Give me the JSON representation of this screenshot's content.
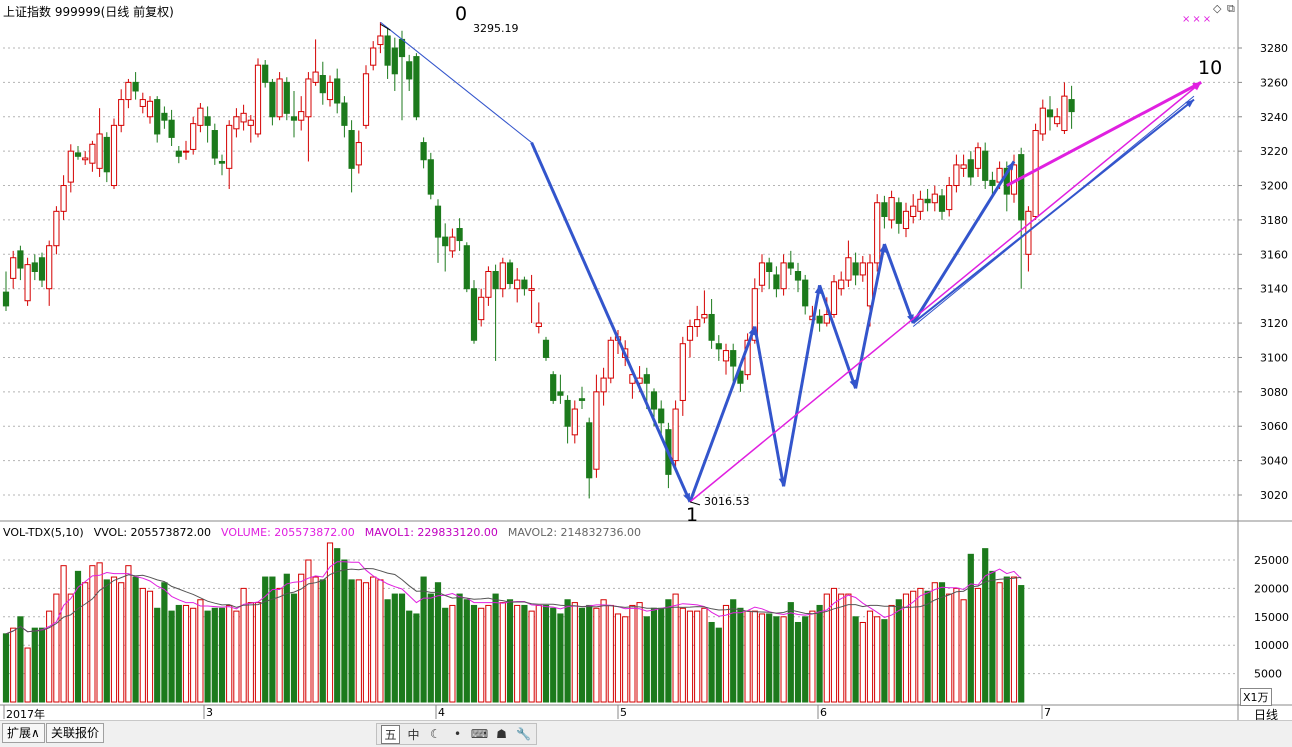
{
  "header": {
    "title": "上证指数 999999(日线 前复权)",
    "icon_labels": [
      "diamond-icon",
      "restore-window-icon"
    ],
    "marks": "×××"
  },
  "wave_labels": {
    "label_0": "0",
    "label_1": "1",
    "label_10": "10",
    "high_value": "3295.19",
    "low_value": "3016.53"
  },
  "volume_header": {
    "name": "VOL-TDX(5,10)",
    "vvol": "VVOL: 205573872.00",
    "volume": "VOLUME: 205573872.00",
    "mavol1": "MAVOL1: 229833120.00",
    "mavol2": "MAVOL2: 214832736.00"
  },
  "x_axis": {
    "labels": [
      "2017年",
      "3",
      "4",
      "5",
      "6",
      "7"
    ],
    "period_label": "日线"
  },
  "volume_unit": "X1万",
  "bottom_tabs": [
    "扩展∧",
    "关联报价"
  ],
  "toolbar": {
    "items": [
      {
        "icon": "calendar-icon",
        "glyph": "五"
      },
      {
        "icon": "text-icon",
        "glyph": "中"
      },
      {
        "icon": "moon-icon",
        "glyph": "☾"
      },
      {
        "icon": "dot-icon",
        "glyph": "•"
      },
      {
        "icon": "keyboard-icon",
        "glyph": "⌨"
      },
      {
        "icon": "user-icon",
        "glyph": "☗"
      },
      {
        "icon": "wrench-icon",
        "glyph": "🔧"
      }
    ]
  },
  "colors": {
    "up": "#d40000",
    "down": "#1c7a1c",
    "wave_blue": "#3355cc",
    "magenta": "#e020e0",
    "grid": "#b4b4b4"
  },
  "chart_data": {
    "type": "candlestick",
    "price_axis": {
      "ticks": [
        3020,
        3040,
        3060,
        3080,
        3100,
        3120,
        3140,
        3160,
        3180,
        3200,
        3220,
        3240,
        3260,
        3280
      ],
      "range": [
        3010,
        3300
      ]
    },
    "volume_axis": {
      "ticks": [
        5000,
        10000,
        15000,
        20000,
        25000
      ],
      "range": [
        0,
        30000
      ],
      "unit": "X1万"
    },
    "candles": [
      [
        3138,
        3130,
        3150,
        3127
      ],
      [
        3146,
        3158,
        3162,
        3140
      ],
      [
        3162,
        3152,
        3165,
        3145
      ],
      [
        3133,
        3154,
        3158,
        3130
      ],
      [
        3155,
        3150,
        3160,
        3145
      ],
      [
        3158,
        3145,
        3161,
        3141
      ],
      [
        3140,
        3165,
        3168,
        3130
      ],
      [
        3165,
        3185,
        3188,
        3160
      ],
      [
        3185,
        3200,
        3206,
        3180
      ],
      [
        3202,
        3220,
        3224,
        3196
      ],
      [
        3219,
        3217,
        3223,
        3215
      ],
      [
        3215,
        3216,
        3220,
        3212
      ],
      [
        3213,
        3224,
        3226,
        3208
      ],
      [
        3210,
        3230,
        3245,
        3205
      ],
      [
        3228,
        3208,
        3231,
        3202
      ],
      [
        3200,
        3235,
        3239,
        3198
      ],
      [
        3235,
        3250,
        3256,
        3231
      ],
      [
        3250,
        3260,
        3262,
        3245
      ],
      [
        3260,
        3255,
        3266,
        3250
      ],
      [
        3246,
        3250,
        3254,
        3242
      ],
      [
        3240,
        3249,
        3252,
        3236
      ],
      [
        3250,
        3230,
        3252,
        3225
      ],
      [
        3242,
        3238,
        3246,
        3233
      ],
      [
        3238,
        3228,
        3244,
        3223
      ],
      [
        3220,
        3217,
        3223,
        3213
      ],
      [
        3220,
        3220,
        3226,
        3215
      ],
      [
        3221,
        3236,
        3240,
        3218
      ],
      [
        3235,
        3245,
        3248,
        3231
      ],
      [
        3240,
        3235,
        3246,
        3225
      ],
      [
        3232,
        3216,
        3236,
        3212
      ],
      [
        3214,
        3213,
        3218,
        3206
      ],
      [
        3210,
        3235,
        3238,
        3198
      ],
      [
        3233,
        3240,
        3245,
        3228
      ],
      [
        3237,
        3242,
        3247,
        3232
      ],
      [
        3235,
        3238,
        3241,
        3225
      ],
      [
        3230,
        3270,
        3274,
        3228
      ],
      [
        3270,
        3260,
        3273,
        3257
      ],
      [
        3260,
        3240,
        3262,
        3235
      ],
      [
        3240,
        3262,
        3266,
        3238
      ],
      [
        3260,
        3242,
        3263,
        3238
      ],
      [
        3240,
        3238,
        3255,
        3228
      ],
      [
        3238,
        3243,
        3252,
        3232
      ],
      [
        3240,
        3262,
        3266,
        3214
      ],
      [
        3260,
        3266,
        3285,
        3258
      ],
      [
        3264,
        3254,
        3272,
        3247
      ],
      [
        3250,
        3260,
        3264,
        3246
      ],
      [
        3262,
        3248,
        3268,
        3242
      ],
      [
        3248,
        3235,
        3252,
        3228
      ],
      [
        3232,
        3210,
        3238,
        3196
      ],
      [
        3212,
        3225,
        3232,
        3207
      ],
      [
        3235,
        3265,
        3270,
        3233
      ],
      [
        3270,
        3280,
        3284,
        3267
      ],
      [
        3282,
        3287,
        3295,
        3277
      ],
      [
        3287,
        3270,
        3292,
        3262
      ],
      [
        3280,
        3265,
        3286,
        3255
      ],
      [
        3285,
        3275,
        3290,
        3238
      ],
      [
        3272,
        3262,
        3276,
        3255
      ],
      [
        3275,
        3240,
        3277,
        3238
      ],
      [
        3225,
        3215,
        3228,
        3210
      ],
      [
        3215,
        3195,
        3219,
        3192
      ],
      [
        3188,
        3170,
        3192,
        3155
      ],
      [
        3170,
        3165,
        3178,
        3150
      ],
      [
        3162,
        3170,
        3175,
        3158
      ],
      [
        3175,
        3168,
        3181,
        3162
      ],
      [
        3165,
        3140,
        3167,
        3138
      ],
      [
        3140,
        3110,
        3145,
        3108
      ],
      [
        3122,
        3135,
        3140,
        3118
      ],
      [
        3135,
        3150,
        3153,
        3130
      ],
      [
        3150,
        3140,
        3154,
        3098
      ],
      [
        3140,
        3155,
        3158,
        3135
      ],
      [
        3155,
        3143,
        3157,
        3140
      ],
      [
        3140,
        3145,
        3152,
        3132
      ],
      [
        3145,
        3140,
        3147,
        3136
      ],
      [
        3139,
        3140,
        3148,
        3120
      ],
      [
        3118,
        3120,
        3132,
        3114
      ],
      [
        3110,
        3100,
        3112,
        3098
      ],
      [
        3090,
        3075,
        3092,
        3073
      ],
      [
        3080,
        3078,
        3090,
        3073
      ],
      [
        3075,
        3060,
        3078,
        3050
      ],
      [
        3055,
        3070,
        3075,
        3050
      ],
      [
        3076,
        3075,
        3083,
        3070
      ],
      [
        3062,
        3030,
        3065,
        3018
      ],
      [
        3035,
        3080,
        3090,
        3030
      ],
      [
        3080,
        3088,
        3094,
        3072
      ],
      [
        3088,
        3110,
        3112,
        3085
      ],
      [
        3110,
        3112,
        3116,
        3102
      ],
      [
        3100,
        3105,
        3110,
        3095
      ],
      [
        3085,
        3090,
        3092,
        3076
      ],
      [
        3085,
        3088,
        3095,
        3080
      ],
      [
        3090,
        3085,
        3094,
        3070
      ],
      [
        3080,
        3070,
        3082,
        3060
      ],
      [
        3070,
        3062,
        3075,
        3055
      ],
      [
        3058,
        3032,
        3062,
        3024
      ],
      [
        3040,
        3070,
        3075,
        3036
      ],
      [
        3075,
        3108,
        3112,
        3066
      ],
      [
        3110,
        3118,
        3122,
        3100
      ],
      [
        3118,
        3122,
        3130,
        3112
      ],
      [
        3123,
        3125,
        3139,
        3120
      ],
      [
        3125,
        3110,
        3134,
        3105
      ],
      [
        3108,
        3105,
        3113,
        3098
      ],
      [
        3098,
        3104,
        3108,
        3090
      ],
      [
        3104,
        3095,
        3108,
        3086
      ],
      [
        3092,
        3085,
        3095,
        3080
      ],
      [
        3090,
        3110,
        3114,
        3087
      ],
      [
        3110,
        3140,
        3146,
        3108
      ],
      [
        3142,
        3155,
        3160,
        3138
      ],
      [
        3155,
        3150,
        3158,
        3140
      ],
      [
        3148,
        3140,
        3153,
        3135
      ],
      [
        3140,
        3155,
        3160,
        3136
      ],
      [
        3155,
        3152,
        3162,
        3148
      ],
      [
        3150,
        3145,
        3155,
        3138
      ],
      [
        3145,
        3130,
        3148,
        3125
      ],
      [
        3122,
        3124,
        3130,
        3118
      ],
      [
        3124,
        3120,
        3128,
        3115
      ],
      [
        3120,
        3125,
        3135,
        3118
      ],
      [
        3125,
        3144,
        3148,
        3123
      ],
      [
        3140,
        3145,
        3150,
        3136
      ],
      [
        3145,
        3158,
        3168,
        3141
      ],
      [
        3155,
        3148,
        3161,
        3142
      ],
      [
        3148,
        3155,
        3159,
        3144
      ],
      [
        3130,
        3155,
        3160,
        3118
      ],
      [
        3155,
        3190,
        3195,
        3150
      ],
      [
        3190,
        3182,
        3194,
        3175
      ],
      [
        3180,
        3193,
        3197,
        3175
      ],
      [
        3190,
        3178,
        3193,
        3172
      ],
      [
        3175,
        3185,
        3190,
        3170
      ],
      [
        3182,
        3188,
        3195,
        3178
      ],
      [
        3185,
        3192,
        3197,
        3180
      ],
      [
        3192,
        3190,
        3198,
        3185
      ],
      [
        3190,
        3195,
        3200,
        3185
      ],
      [
        3194,
        3185,
        3198,
        3180
      ],
      [
        3186,
        3200,
        3205,
        3182
      ],
      [
        3200,
        3212,
        3218,
        3196
      ],
      [
        3210,
        3212,
        3218,
        3205
      ],
      [
        3215,
        3205,
        3220,
        3200
      ],
      [
        3210,
        3222,
        3225,
        3205
      ],
      [
        3220,
        3203,
        3225,
        3198
      ],
      [
        3203,
        3200,
        3208,
        3194
      ],
      [
        3202,
        3210,
        3214,
        3198
      ],
      [
        3210,
        3195,
        3214,
        3185
      ],
      [
        3195,
        3212,
        3218,
        3190
      ],
      [
        3218,
        3180,
        3222,
        3140
      ],
      [
        3160,
        3185,
        3188,
        3150
      ],
      [
        3182,
        3232,
        3236,
        3180
      ],
      [
        3230,
        3245,
        3250,
        3226
      ],
      [
        3244,
        3240,
        3252,
        3232
      ],
      [
        3236,
        3240,
        3245,
        3234
      ],
      [
        3232,
        3252,
        3260,
        3230
      ],
      [
        3250,
        3243,
        3258,
        3233
      ]
    ],
    "volume": [
      12000,
      13000,
      15000,
      9500,
      13000,
      13000,
      16000,
      19000,
      24000,
      19000,
      23000,
      21000,
      24000,
      24500,
      21500,
      22000,
      21000,
      24000,
      22000,
      20000,
      19500,
      16500,
      21000,
      16000,
      17000,
      17000,
      16500,
      18000,
      16000,
      16500,
      16500,
      17000,
      16000,
      20000,
      17500,
      17500,
      22000,
      22000,
      20000,
      22500,
      19000,
      22500,
      25000,
      22000,
      21500,
      28000,
      27000,
      25000,
      21500,
      21500,
      21000,
      22000,
      21500,
      18000,
      19000,
      19000,
      16000,
      15500,
      22000,
      19000,
      21000,
      16500,
      17000,
      19000,
      18000,
      17000,
      16500,
      17000,
      19000,
      17500,
      18000,
      17000,
      17000,
      16000,
      17000,
      17000,
      16500,
      15500,
      18000,
      17500,
      16500,
      17000,
      16500,
      18000,
      17000,
      15500,
      15000,
      17000,
      17500,
      15000,
      16500,
      16500,
      18000,
      19000,
      16500,
      16000,
      16000,
      16500,
      14000,
      13000,
      17000,
      18000,
      16500,
      16000,
      16000,
      15500,
      15500,
      15000,
      15000,
      17500,
      14000,
      15000,
      16000,
      17000,
      19000,
      20000,
      19000,
      19000,
      15000,
      14000,
      16000,
      15000,
      14500,
      17000,
      18000,
      19000,
      19500,
      20000,
      19500,
      21000,
      21000,
      19000,
      20000,
      18000,
      26000,
      20000,
      27000,
      23000,
      21000,
      22000,
      22000,
      20500
    ]
  }
}
